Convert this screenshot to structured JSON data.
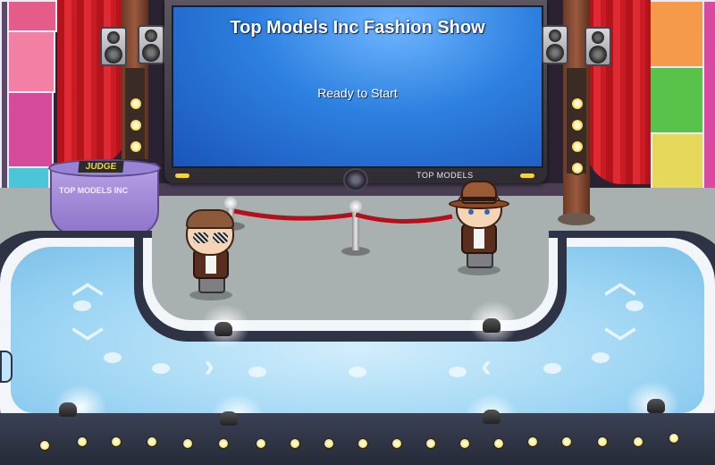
{
  "screen": {
    "title": "Top Models Inc Fashion Show",
    "status": "Ready to Start",
    "brand": "TOP MODELS"
  },
  "judge_table": {
    "sign": "JUDGE",
    "logo": "TOP MODELS INC"
  },
  "colors": {
    "screen_blue": "#2d80e0",
    "curtain_red": "#c81b24",
    "runway_blue": "#9fd6f4",
    "judge_purple": "#8d74c9"
  },
  "avatars": [
    {
      "name": "player-avatar-glasses",
      "icon": "sunglasses-icon"
    },
    {
      "name": "player-avatar-fedora",
      "icon": "fedora-hat-icon"
    }
  ]
}
